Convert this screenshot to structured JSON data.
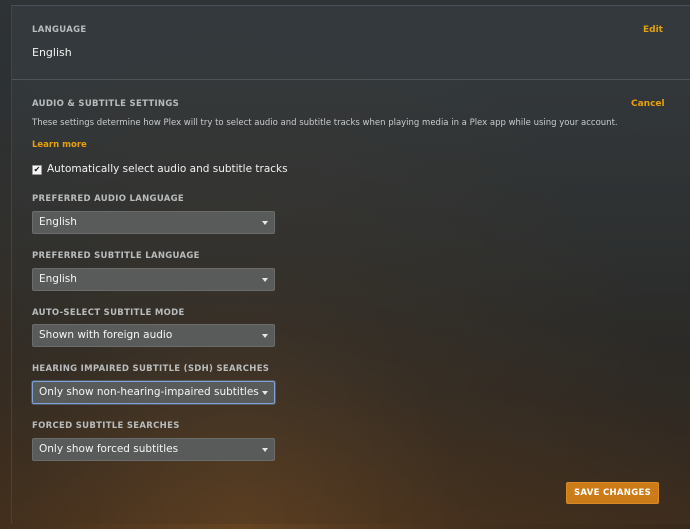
{
  "language_section": {
    "title": "LANGUAGE",
    "edit_label": "Edit",
    "value": "English"
  },
  "audio_section": {
    "title": "AUDIO & SUBTITLE SETTINGS",
    "cancel_label": "Cancel",
    "description": "These settings determine how Plex will try to select audio and subtitle tracks when playing media in a Plex app while using your account.",
    "learn_more": "Learn more",
    "auto_select": {
      "checked": true,
      "check_glyph": "✔",
      "label": "Automatically select audio and subtitle tracks"
    },
    "fields": [
      {
        "label": "PREFERRED AUDIO LANGUAGE",
        "value": "English"
      },
      {
        "label": "PREFERRED SUBTITLE LANGUAGE",
        "value": "English"
      },
      {
        "label": "AUTO-SELECT SUBTITLE MODE",
        "value": "Shown with foreign audio"
      },
      {
        "label": "HEARING IMPAIRED SUBTITLE (SDH) SEARCHES",
        "value": "Only show non-hearing-impaired subtitles"
      },
      {
        "label": "FORCED SUBTITLE SEARCHES",
        "value": "Only show forced subtitles"
      }
    ],
    "save_label": "SAVE CHANGES"
  },
  "colors": {
    "accent": "#e5a00d",
    "button": "#cc7b19",
    "focus": "#7fa2d6"
  }
}
